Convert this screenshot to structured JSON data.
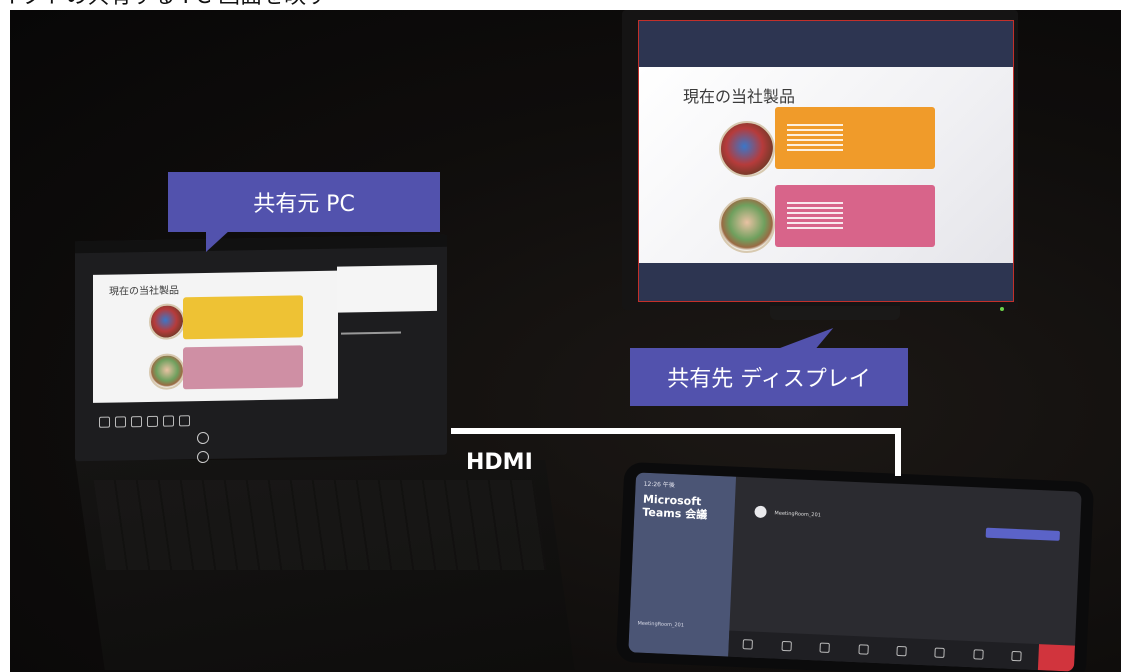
{
  "page_caption": "イクトの共有する PC 画面を映す",
  "callouts": {
    "source_label": "共有元 PC",
    "target_label": "共有先 ディスプレイ"
  },
  "connector": {
    "label": "HDMI"
  },
  "slide": {
    "title": "現在の当社製品"
  },
  "teams_device": {
    "title": "Microsoft Teams 会議",
    "time": "12:26 午後",
    "room": "MeetingRoom_201"
  }
}
